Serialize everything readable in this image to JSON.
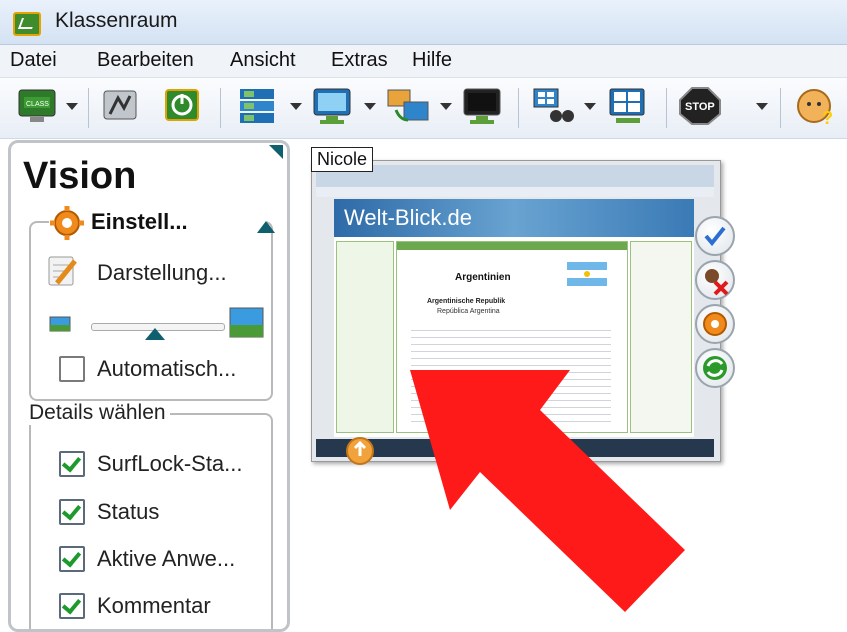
{
  "window": {
    "title": "Klassenraum"
  },
  "menu": [
    "Datei",
    "Bearbeiten",
    "Ansicht",
    "Extras",
    "Hilfe"
  ],
  "toolbar": {
    "icons": [
      "class-icon",
      "screen-icon",
      "power-icon",
      "view-layout-icon",
      "monitor-icon",
      "share-screen-icon",
      "blank-screen-icon",
      "scan-icon",
      "thumbnail-icon",
      "stop-icon",
      "help-icon"
    ],
    "stop_label": "STOP",
    "class_label": "CLASS"
  },
  "panel": {
    "heading": "Vision",
    "settings": {
      "title": "Einstell...",
      "display_label": "Darstellung...",
      "auto_label": "Automatisch...",
      "auto_checked": false,
      "slider_value": 0.5
    },
    "details": {
      "title": "Details wählen",
      "items": [
        {
          "label": "SurfLock-Sta...",
          "checked": true
        },
        {
          "label": "Status",
          "checked": true
        },
        {
          "label": "Aktive Anwe...",
          "checked": true
        },
        {
          "label": "Kommentar",
          "checked": true
        }
      ]
    }
  },
  "thumbnail": {
    "student_name": "Nicole",
    "site_title": "Welt-Blick.de",
    "page_heading": "Argentinien",
    "page_subheading": "Argentinische Republik",
    "page_sub2": "República Argentina"
  },
  "colors": {
    "arrow": "#ff1a1a",
    "accent": "#1f7ba8"
  }
}
